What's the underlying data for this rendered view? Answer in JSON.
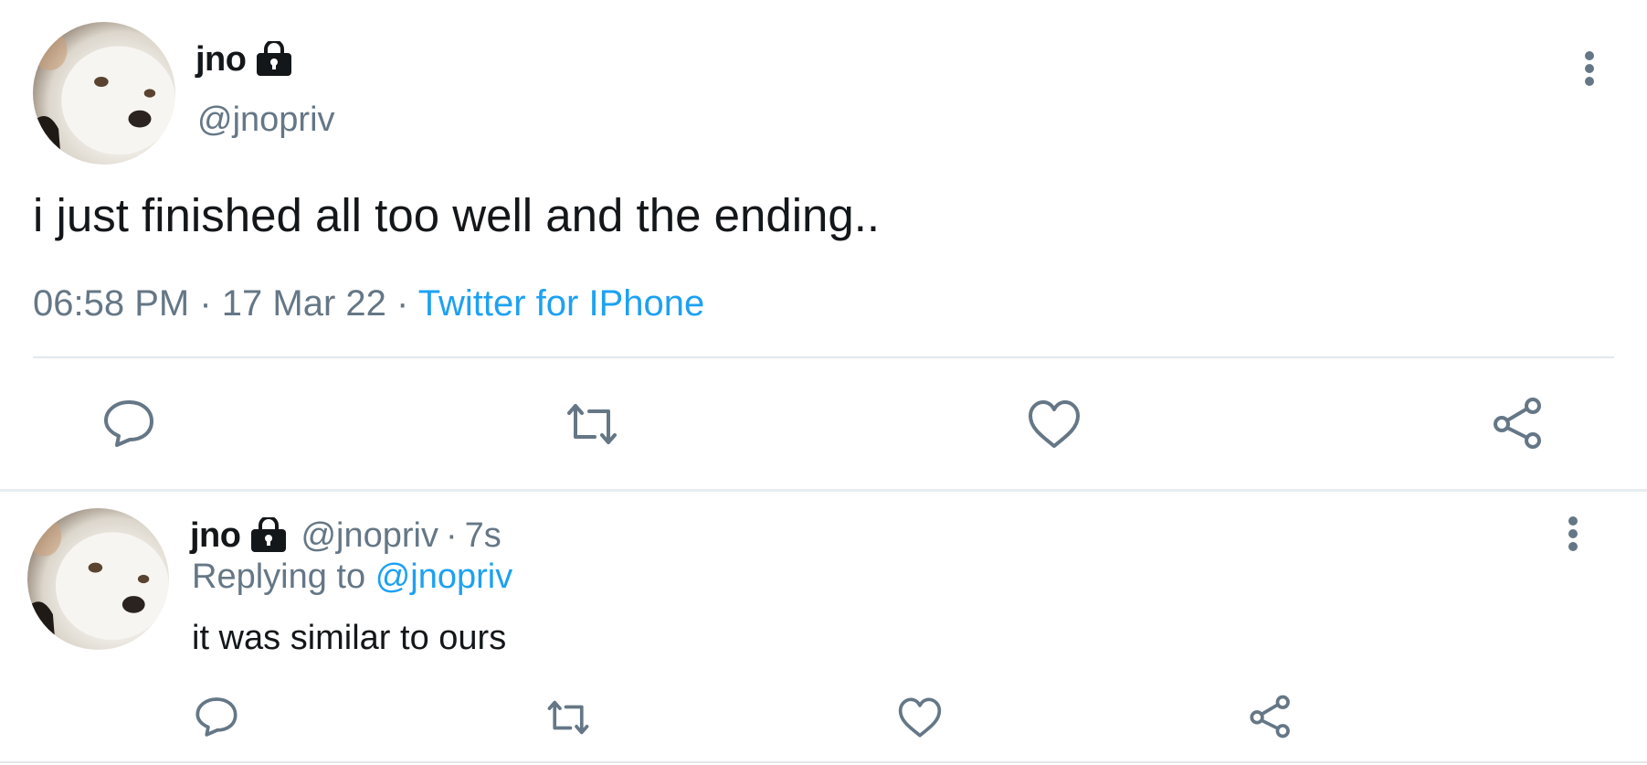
{
  "main_tweet": {
    "display_name": "jno",
    "handle": "@jnopriv",
    "text": "i just finished all too well and the ending..",
    "time": "06:58 PM",
    "dot1": "·",
    "date": "17 Mar 22",
    "dot2": "·",
    "source": "Twitter for IPhone"
  },
  "reply_tweet": {
    "display_name": "jno",
    "handle": "@jnopriv",
    "dot": "·",
    "age": "7s",
    "replying_prefix": "Replying to",
    "replying_to": "@jnopriv",
    "text": "it was similar to ours"
  },
  "colors": {
    "text": "#14171a",
    "muted": "#657786",
    "link": "#1da1f2",
    "divider": "#e1e8ed"
  },
  "icons": [
    "lock-icon",
    "more-icon",
    "reply-icon",
    "retweet-icon",
    "like-icon",
    "share-icon"
  ]
}
